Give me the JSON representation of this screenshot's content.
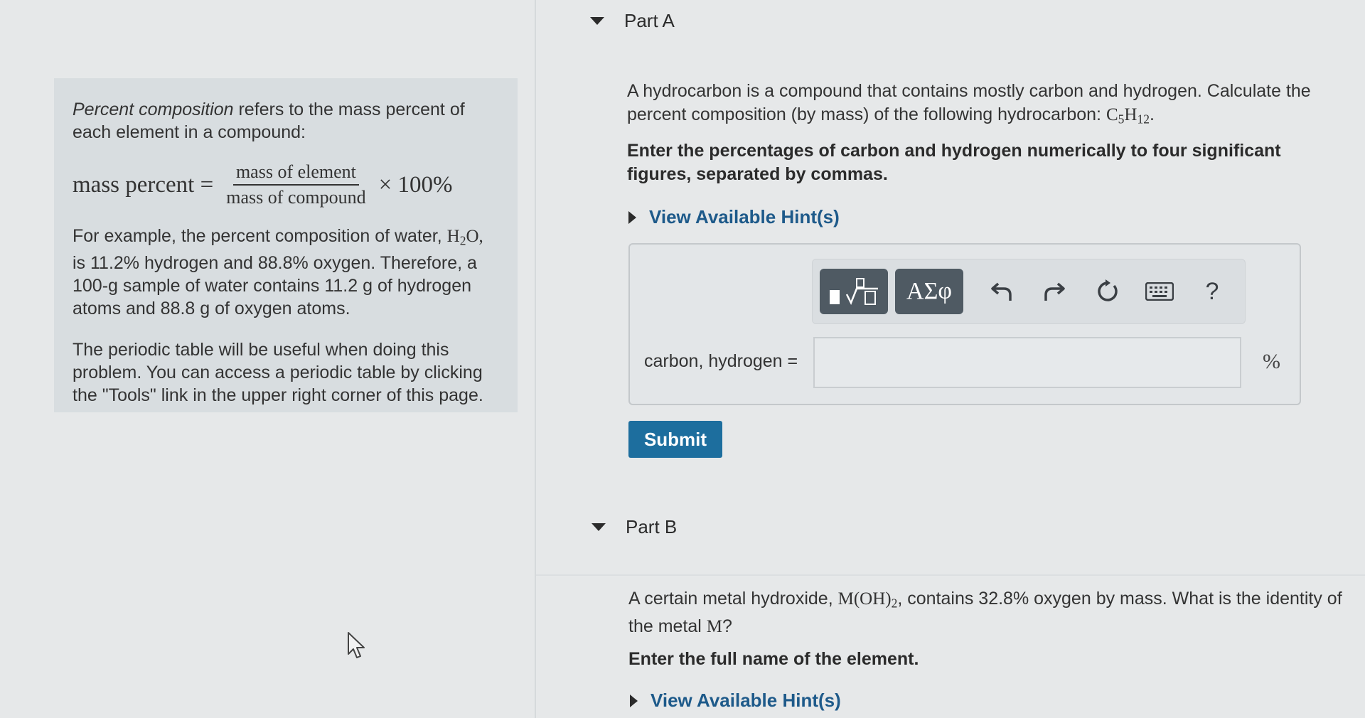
{
  "left": {
    "intro_em": "Percent composition",
    "intro_rest": " refers to the mass percent of each element in a compound:",
    "formula": {
      "lhs": "mass percent =",
      "numerator": "mass of element",
      "denominator": "mass of compound",
      "rhs": "× 100%"
    },
    "example_1": "For example, the percent composition of water, ",
    "example_formula_h": "H",
    "example_formula_sub": "2",
    "example_formula_o": "O,",
    "example_2": " is 11.2% hydrogen and 88.8% oxygen. Therefore, a 100-g sample of water contains 11.2 g of hydrogen atoms and 88.8 g of oxygen atoms.",
    "periodic_note": "The periodic table will be useful when doing this problem. You can access a periodic table by clicking the \"Tools\" link in the upper right corner of this page."
  },
  "part_a": {
    "title": "Part A",
    "question_1": "A hydrocarbon is a compound that contains mostly carbon and hydrogen. Calculate the percent composition (by mass) of the following hydrocarbon: ",
    "formula_c": "C",
    "formula_c_sub": "5",
    "formula_h": "H",
    "formula_h_sub": "12",
    "formula_end": ".",
    "instruction": "Enter the percentages of carbon and hydrogen numerically to four significant figures, separated by commas.",
    "hint_label": "View Available Hint(s)",
    "toolbar": {
      "templates_label": "▮√▯",
      "greek_label": "ΑΣφ",
      "undo": "↶",
      "redo": "↷",
      "reset": "↻",
      "keyboard": "⌨",
      "help": "?"
    },
    "answer_label": "carbon, hydrogen =",
    "answer_value": "",
    "unit": "%",
    "submit_label": "Submit"
  },
  "part_b": {
    "title": "Part B",
    "question_1": "A certain metal hydroxide, ",
    "formula": "M(OH)",
    "formula_sub": "2",
    "question_2": ", contains 32.8% oxygen by mass. What is the identity of the metal ",
    "metal": "M",
    "question_end": "?",
    "instruction": "Enter the full name of the element.",
    "hint_label": "View Available Hint(s)"
  }
}
